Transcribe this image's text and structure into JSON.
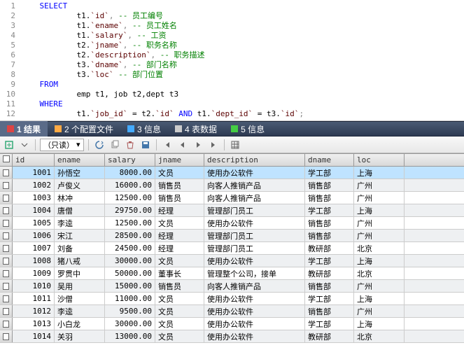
{
  "editor": {
    "lines": [
      {
        "n": 1,
        "segs": [
          {
            "t": "    ",
            "c": ""
          },
          {
            "t": "SELECT",
            "c": "kw"
          }
        ]
      },
      {
        "n": 2,
        "segs": [
          {
            "t": "            t1.",
            "c": ""
          },
          {
            "t": "`id`",
            "c": "id"
          },
          {
            "t": ", ",
            "c": "op"
          },
          {
            "t": "-- 员工编号",
            "c": "cm"
          }
        ]
      },
      {
        "n": 3,
        "segs": [
          {
            "t": "            t1.",
            "c": ""
          },
          {
            "t": "`ename`",
            "c": "id"
          },
          {
            "t": ", ",
            "c": "op"
          },
          {
            "t": "-- 员工姓名",
            "c": "cm"
          }
        ]
      },
      {
        "n": 4,
        "segs": [
          {
            "t": "            t1.",
            "c": ""
          },
          {
            "t": "`salary`",
            "c": "id"
          },
          {
            "t": ", ",
            "c": "op"
          },
          {
            "t": "-- 工资",
            "c": "cm"
          }
        ]
      },
      {
        "n": 5,
        "segs": [
          {
            "t": "            t2.",
            "c": ""
          },
          {
            "t": "`jname`",
            "c": "id"
          },
          {
            "t": ", ",
            "c": "op"
          },
          {
            "t": "-- 职务名称",
            "c": "cm"
          }
        ]
      },
      {
        "n": 6,
        "segs": [
          {
            "t": "            t2.",
            "c": ""
          },
          {
            "t": "`description`",
            "c": "id"
          },
          {
            "t": ", ",
            "c": "op"
          },
          {
            "t": "-- 职务描述",
            "c": "cm"
          }
        ]
      },
      {
        "n": 7,
        "segs": [
          {
            "t": "            t3.",
            "c": ""
          },
          {
            "t": "`dname`",
            "c": "id"
          },
          {
            "t": ", ",
            "c": "op"
          },
          {
            "t": "-- 部门名称",
            "c": "cm"
          }
        ]
      },
      {
        "n": 8,
        "segs": [
          {
            "t": "            t3.",
            "c": ""
          },
          {
            "t": "`loc`",
            "c": "id"
          },
          {
            "t": " ",
            "c": ""
          },
          {
            "t": "-- 部门位置",
            "c": "cm"
          }
        ]
      },
      {
        "n": 9,
        "segs": [
          {
            "t": "    ",
            "c": ""
          },
          {
            "t": "FROM",
            "c": "kw"
          }
        ]
      },
      {
        "n": 10,
        "segs": [
          {
            "t": "            emp t1, job t2,dept t3",
            "c": ""
          }
        ]
      },
      {
        "n": 11,
        "segs": [
          {
            "t": "    ",
            "c": ""
          },
          {
            "t": "WHERE",
            "c": "kw"
          }
        ]
      },
      {
        "n": 12,
        "segs": [
          {
            "t": "            t1.",
            "c": ""
          },
          {
            "t": "`job_id`",
            "c": "id"
          },
          {
            "t": " = t2.",
            "c": ""
          },
          {
            "t": "`id`",
            "c": "id"
          },
          {
            "t": " ",
            "c": ""
          },
          {
            "t": "AND",
            "c": "kw"
          },
          {
            "t": " t1.",
            "c": ""
          },
          {
            "t": "`dept_id`",
            "c": "id"
          },
          {
            "t": " = t3.",
            "c": ""
          },
          {
            "t": "`id`",
            "c": "id"
          },
          {
            "t": ";",
            "c": "op"
          }
        ]
      }
    ]
  },
  "tabs": [
    {
      "label": "1 结果",
      "active": true
    },
    {
      "label": "2 个配置文件",
      "active": false
    },
    {
      "label": "3 信息",
      "active": false
    },
    {
      "label": "4 表数据",
      "active": false
    },
    {
      "label": "5 信息",
      "active": false
    }
  ],
  "toolbar": {
    "readonly_label": "（只读）"
  },
  "grid": {
    "headers": [
      "id",
      "ename",
      "salary",
      "jname",
      "description",
      "dname",
      "loc"
    ],
    "rows": [
      {
        "id": "1001",
        "ename": "孙悟空",
        "salary": "8000.00",
        "jname": "文员",
        "desc": "使用办公软件",
        "dname": "学工部",
        "loc": "上海",
        "sel": true
      },
      {
        "id": "1002",
        "ename": "卢俊义",
        "salary": "16000.00",
        "jname": "销售员",
        "desc": "向客人推销产品",
        "dname": "销售部",
        "loc": "广州"
      },
      {
        "id": "1003",
        "ename": "林冲",
        "salary": "12500.00",
        "jname": "销售员",
        "desc": "向客人推销产品",
        "dname": "销售部",
        "loc": "广州"
      },
      {
        "id": "1004",
        "ename": "唐僧",
        "salary": "29750.00",
        "jname": "经理",
        "desc": "管理部门员工",
        "dname": "学工部",
        "loc": "上海"
      },
      {
        "id": "1005",
        "ename": "李逵",
        "salary": "12500.00",
        "jname": "文员",
        "desc": "使用办公软件",
        "dname": "销售部",
        "loc": "广州"
      },
      {
        "id": "1006",
        "ename": "宋江",
        "salary": "28500.00",
        "jname": "经理",
        "desc": "管理部门员工",
        "dname": "销售部",
        "loc": "广州"
      },
      {
        "id": "1007",
        "ename": "刘备",
        "salary": "24500.00",
        "jname": "经理",
        "desc": "管理部门员工",
        "dname": "教研部",
        "loc": "北京"
      },
      {
        "id": "1008",
        "ename": "猪八戒",
        "salary": "30000.00",
        "jname": "文员",
        "desc": "使用办公软件",
        "dname": "学工部",
        "loc": "上海"
      },
      {
        "id": "1009",
        "ename": "罗贯中",
        "salary": "50000.00",
        "jname": "董事长",
        "desc": "管理整个公司，接单",
        "dname": "教研部",
        "loc": "北京"
      },
      {
        "id": "1010",
        "ename": "吴用",
        "salary": "15000.00",
        "jname": "销售员",
        "desc": "向客人推销产品",
        "dname": "销售部",
        "loc": "广州"
      },
      {
        "id": "1011",
        "ename": "沙僧",
        "salary": "11000.00",
        "jname": "文员",
        "desc": "使用办公软件",
        "dname": "学工部",
        "loc": "上海"
      },
      {
        "id": "1012",
        "ename": "李逵",
        "salary": "9500.00",
        "jname": "文员",
        "desc": "使用办公软件",
        "dname": "销售部",
        "loc": "广州"
      },
      {
        "id": "1013",
        "ename": "小白龙",
        "salary": "30000.00",
        "jname": "文员",
        "desc": "使用办公软件",
        "dname": "学工部",
        "loc": "上海"
      },
      {
        "id": "1014",
        "ename": "关羽",
        "salary": "13000.00",
        "jname": "文员",
        "desc": "使用办公软件",
        "dname": "教研部",
        "loc": "北京"
      }
    ]
  }
}
